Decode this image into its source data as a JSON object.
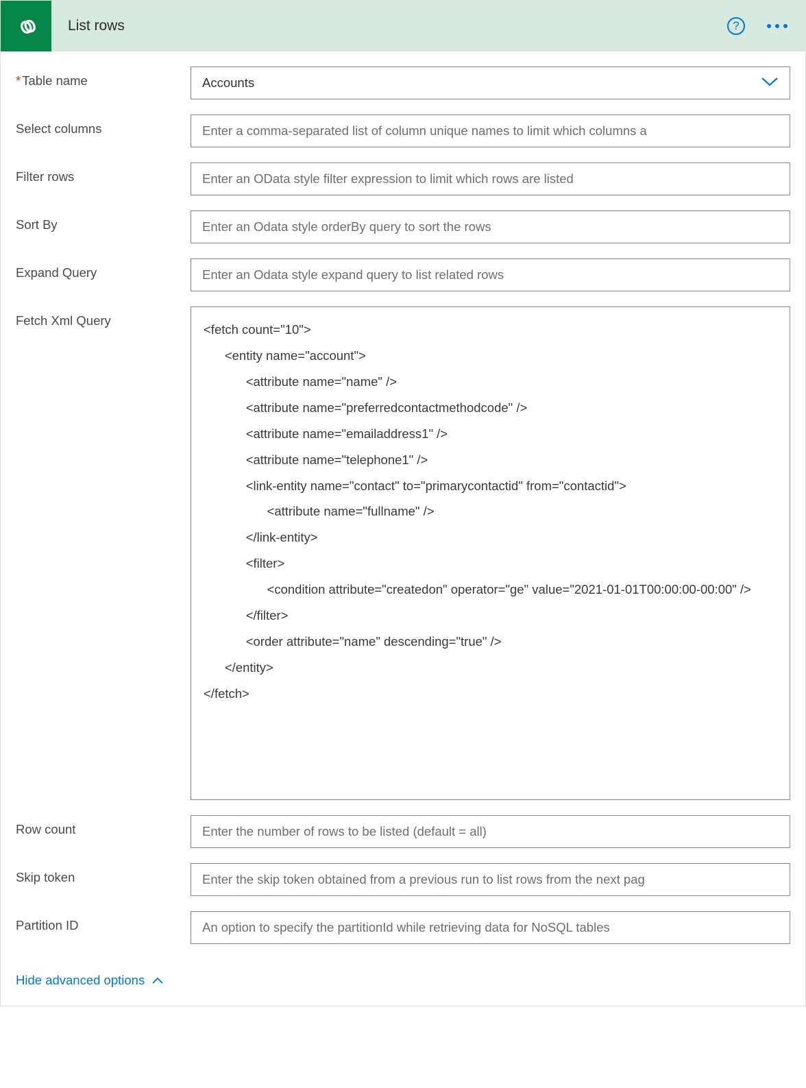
{
  "header": {
    "title": "List rows"
  },
  "fields": {
    "tableName": {
      "label": "Table name",
      "required": true,
      "value": "Accounts"
    },
    "selectColumns": {
      "label": "Select columns",
      "placeholder": "Enter a comma-separated list of column unique names to limit which columns a"
    },
    "filterRows": {
      "label": "Filter rows",
      "placeholder": "Enter an OData style filter expression to limit which rows are listed"
    },
    "sortBy": {
      "label": "Sort By",
      "placeholder": "Enter an Odata style orderBy query to sort the rows"
    },
    "expandQuery": {
      "label": "Expand Query",
      "placeholder": "Enter an Odata style expand query to list related rows"
    },
    "fetchXml": {
      "label": "Fetch Xml Query",
      "value": "<fetch count=\"10\">\n      <entity name=\"account\">\n            <attribute name=\"name\" />\n            <attribute name=\"preferredcontactmethodcode\" />\n            <attribute name=\"emailaddress1\" />\n            <attribute name=\"telephone1\" />\n            <link-entity name=\"contact\" to=\"primarycontactid\" from=\"contactid\">\n                  <attribute name=\"fullname\" />\n            </link-entity>\n            <filter>\n                  <condition attribute=\"createdon\" operator=\"ge\" value=\"2021-01-01T00:00:00-00:00\" />\n            </filter>\n            <order attribute=\"name\" descending=\"true\" />\n      </entity>\n</fetch>"
    },
    "rowCount": {
      "label": "Row count",
      "placeholder": "Enter the number of rows to be listed (default = all)"
    },
    "skipToken": {
      "label": "Skip token",
      "placeholder": "Enter the skip token obtained from a previous run to list rows from the next pag"
    },
    "partitionId": {
      "label": "Partition ID",
      "placeholder": "An option to specify the partitionId while retrieving data for NoSQL tables"
    }
  },
  "footer": {
    "toggleLabel": "Hide advanced options"
  }
}
